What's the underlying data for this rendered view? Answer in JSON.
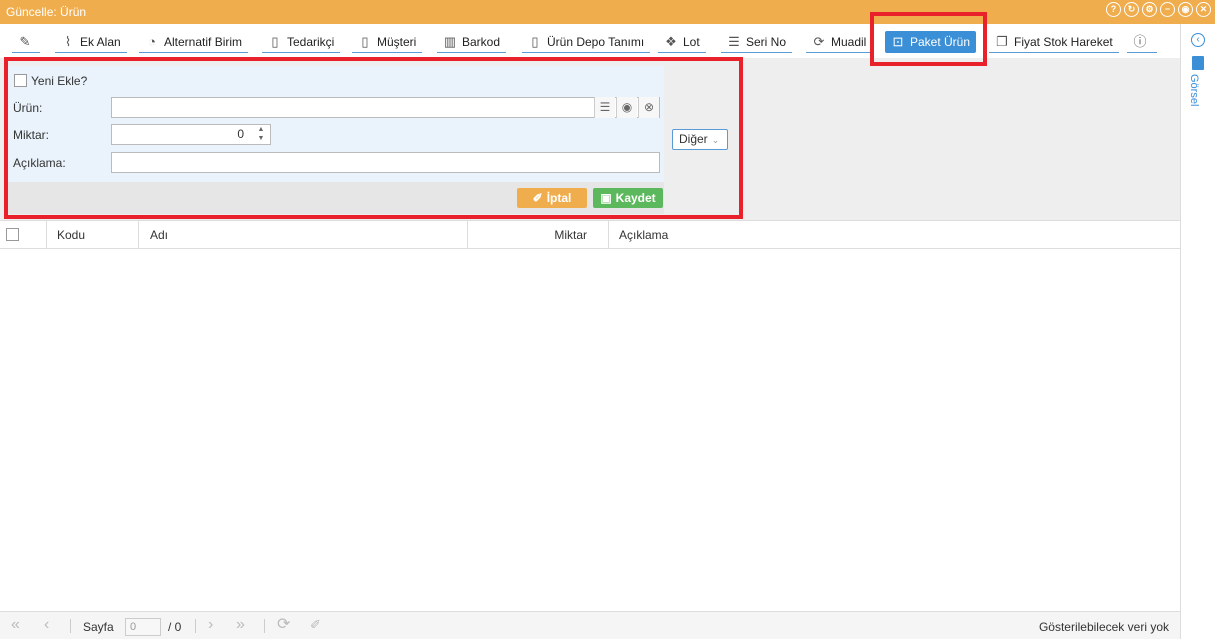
{
  "window": {
    "title": "Güncelle: Ürün",
    "controls": [
      "?",
      "↻",
      "⚙",
      "−",
      "◉",
      "✕"
    ]
  },
  "toolbar": {
    "items": [
      {
        "label": "",
        "icon": "edit-icon"
      },
      {
        "label": "Ek Alan",
        "icon": "paperclip-icon"
      },
      {
        "label": "Alternatif Birim",
        "icon": "gauge-icon"
      },
      {
        "label": "Tedarikçi",
        "icon": "building-icon"
      },
      {
        "label": "Müşteri",
        "icon": "building-icon"
      },
      {
        "label": "Barkod",
        "icon": "barcode-icon"
      },
      {
        "label": "Ürün Depo Tanımı",
        "icon": "building-icon"
      },
      {
        "label": "Lot",
        "icon": "cubes-icon"
      },
      {
        "label": "Seri No",
        "icon": "list-icon"
      },
      {
        "label": "Muadil",
        "icon": "refresh-icon"
      },
      {
        "label": "Paket Ürün",
        "icon": "package-icon",
        "active": true
      },
      {
        "label": "Fiyat Stok Hareket",
        "icon": "copy-icon"
      },
      {
        "label": "",
        "icon": "info-icon"
      }
    ]
  },
  "form": {
    "new_label": "Yeni Ekle?",
    "urun_label": "Ürün:",
    "urun_value": "",
    "miktar_label": "Miktar:",
    "miktar_value": "0",
    "aciklama_label": "Açıklama:",
    "aciklama_value": "",
    "cancel_label": "İptal",
    "save_label": "Kaydet",
    "other_label": "Diğer"
  },
  "grid": {
    "columns": [
      "Kodu",
      "Adı",
      "Miktar",
      "Açıklama"
    ],
    "rows": []
  },
  "pager": {
    "page_label": "Sayfa",
    "page_value": "0",
    "page_total": "/ 0",
    "status": "Gösterilebilecek veri yok"
  },
  "side": {
    "label": "Görsel"
  },
  "colors": {
    "titlebar": "#f0ad4e",
    "active_tab": "#3b8fd6",
    "save": "#5cb85c",
    "cancel": "#f0ad4e",
    "highlight": "#e8212b"
  }
}
